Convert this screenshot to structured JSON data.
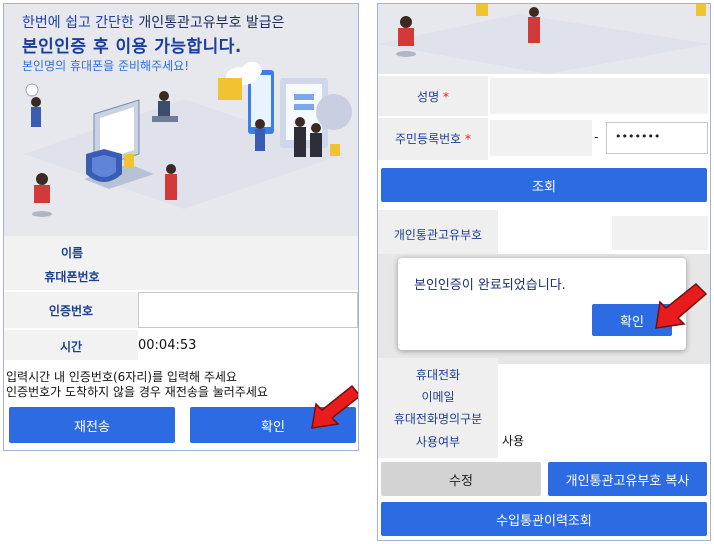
{
  "left": {
    "hero": {
      "line1_highlight": "한번에 쉽고 간단한",
      "line1_rest": " 개인통관고유부호 발급은",
      "line2": "본인인증 후 이용 가능합니다.",
      "line3": "본인명의 휴대폰을 준비해주세요!"
    },
    "form": {
      "name_label": "이름",
      "phone_label": "휴대폰번호",
      "code_label": "인증번호",
      "time_label": "시간",
      "time_value": "00:04:53"
    },
    "notes": {
      "line1": "입력시간 내 인증번호(6자리)를 입력해 주세요",
      "line2": "인증번호가 도착하지 않을 경우 재전송을 눌러주세요"
    },
    "buttons": {
      "resend": "재전송",
      "confirm": "확인"
    }
  },
  "right": {
    "form": {
      "name_label": "성명",
      "rrn_label": "주민등록번호",
      "required_mark": "*",
      "rrn_dash": "-",
      "rrn_back_value": "•••••••"
    },
    "buttons": {
      "lookup": "조회",
      "edit": "수정",
      "copy": "개인통관고유부호 복사",
      "history": "수입통관이력조회",
      "dialog_ok": "확인"
    },
    "result": {
      "code_label": "개인통관고유부호",
      "phone_label": "휴대전화",
      "email_label": "이메일",
      "phone_owner_label": "휴대전화명의구분",
      "use_label": "사용여부",
      "use_value": "사용"
    },
    "dialog": {
      "message": "본인인증이 완료되었습니다."
    }
  },
  "colors": {
    "primary": "#2d6be3",
    "label_blue": "#1d3f8f",
    "hero_bg": "#e6e8ee",
    "arrow_red": "#e81c1c"
  }
}
